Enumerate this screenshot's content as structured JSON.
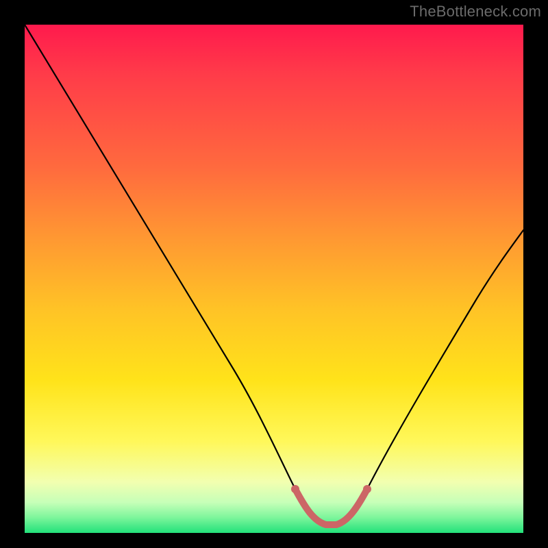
{
  "watermark": "TheBottleneck.com",
  "chart_data": {
    "type": "line",
    "title": "",
    "xlabel": "",
    "ylabel": "",
    "xlim": [
      0,
      1
    ],
    "ylim": [
      0,
      1
    ],
    "grid": false,
    "legend": false,
    "series": [
      {
        "name": "curve",
        "x": [
          0.0,
          0.1,
          0.2,
          0.3,
          0.4,
          0.5,
          0.54,
          0.58,
          0.62,
          0.66,
          0.7,
          0.8,
          0.9,
          1.0
        ],
        "y": [
          1.0,
          0.82,
          0.64,
          0.46,
          0.28,
          0.1,
          0.04,
          0.02,
          0.02,
          0.04,
          0.08,
          0.22,
          0.4,
          0.6
        ]
      }
    ],
    "highlight_segment": {
      "x": [
        0.5,
        0.54,
        0.58,
        0.62,
        0.66
      ],
      "y": [
        0.1,
        0.04,
        0.02,
        0.02,
        0.04
      ],
      "color": "#cc6666"
    },
    "background_gradient_stops": [
      {
        "pos": 0.0,
        "color": "#ff1a4d"
      },
      {
        "pos": 0.28,
        "color": "#ff6a3e"
      },
      {
        "pos": 0.56,
        "color": "#ffc326"
      },
      {
        "pos": 0.82,
        "color": "#fff85a"
      },
      {
        "pos": 0.94,
        "color": "#c6ffb8"
      },
      {
        "pos": 1.0,
        "color": "#22e17a"
      }
    ]
  }
}
